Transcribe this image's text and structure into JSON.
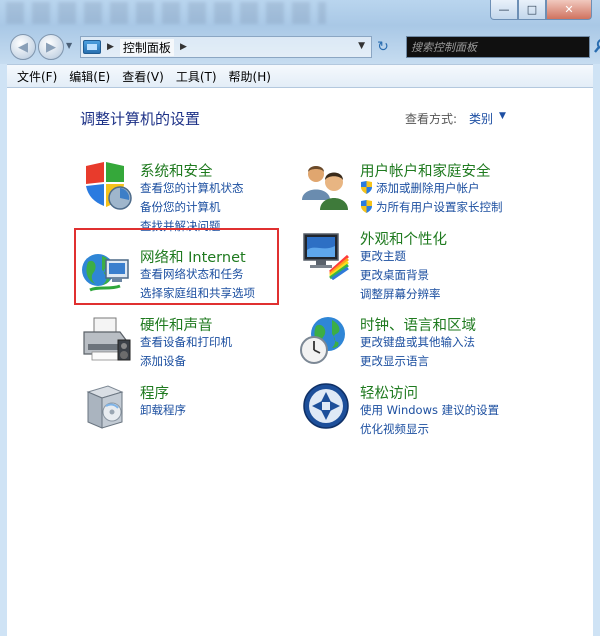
{
  "window": {
    "minimize_glyph": "—",
    "maximize_glyph": "□",
    "close_glyph": "✕"
  },
  "nav": {
    "back_glyph": "◀",
    "forward_glyph": "▶",
    "history_glyph": "▼",
    "breadcrumb_sep": "▶",
    "breadcrumb": "控制面板",
    "breadcrumb_sep2": "▶",
    "address_dropdown": "▼",
    "refresh_glyph": "↻"
  },
  "search": {
    "placeholder": "搜索控制面板"
  },
  "menu": {
    "file": "文件(F)",
    "edit": "编辑(E)",
    "view": "查看(V)",
    "tools": "工具(T)",
    "help": "帮助(H)"
  },
  "page": {
    "title": "调整计算机的设置",
    "view_by_label": "查看方式:",
    "view_by_value": "类别",
    "view_by_arrow": "▼"
  },
  "categories": {
    "system": {
      "title": "系统和安全",
      "links": [
        "查看您的计算机状态",
        "备份您的计算机",
        "查找并解决问题"
      ]
    },
    "network": {
      "title": "网络和 Internet",
      "links": [
        "查看网络状态和任务",
        "选择家庭组和共享选项"
      ]
    },
    "hardware": {
      "title": "硬件和声音",
      "links": [
        "查看设备和打印机",
        "添加设备"
      ]
    },
    "programs": {
      "title": "程序",
      "links": [
        "卸载程序"
      ]
    },
    "users": {
      "title": "用户帐户和家庭安全",
      "links": [
        "添加或删除用户帐户",
        "为所有用户设置家长控制"
      ]
    },
    "appearance": {
      "title": "外观和个性化",
      "links": [
        "更改主题",
        "更改桌面背景",
        "调整屏幕分辨率"
      ]
    },
    "clock": {
      "title": "时钟、语言和区域",
      "links": [
        "更改键盘或其他输入法",
        "更改显示语言"
      ]
    },
    "ease": {
      "title": "轻松访问",
      "links": [
        "使用 Windows 建议的设置",
        "优化视频显示"
      ]
    }
  },
  "colors": {
    "category_title": "#1f7a1f",
    "link": "#1c4fa0",
    "page_title": "#1e3287",
    "highlight": "#e03030"
  }
}
